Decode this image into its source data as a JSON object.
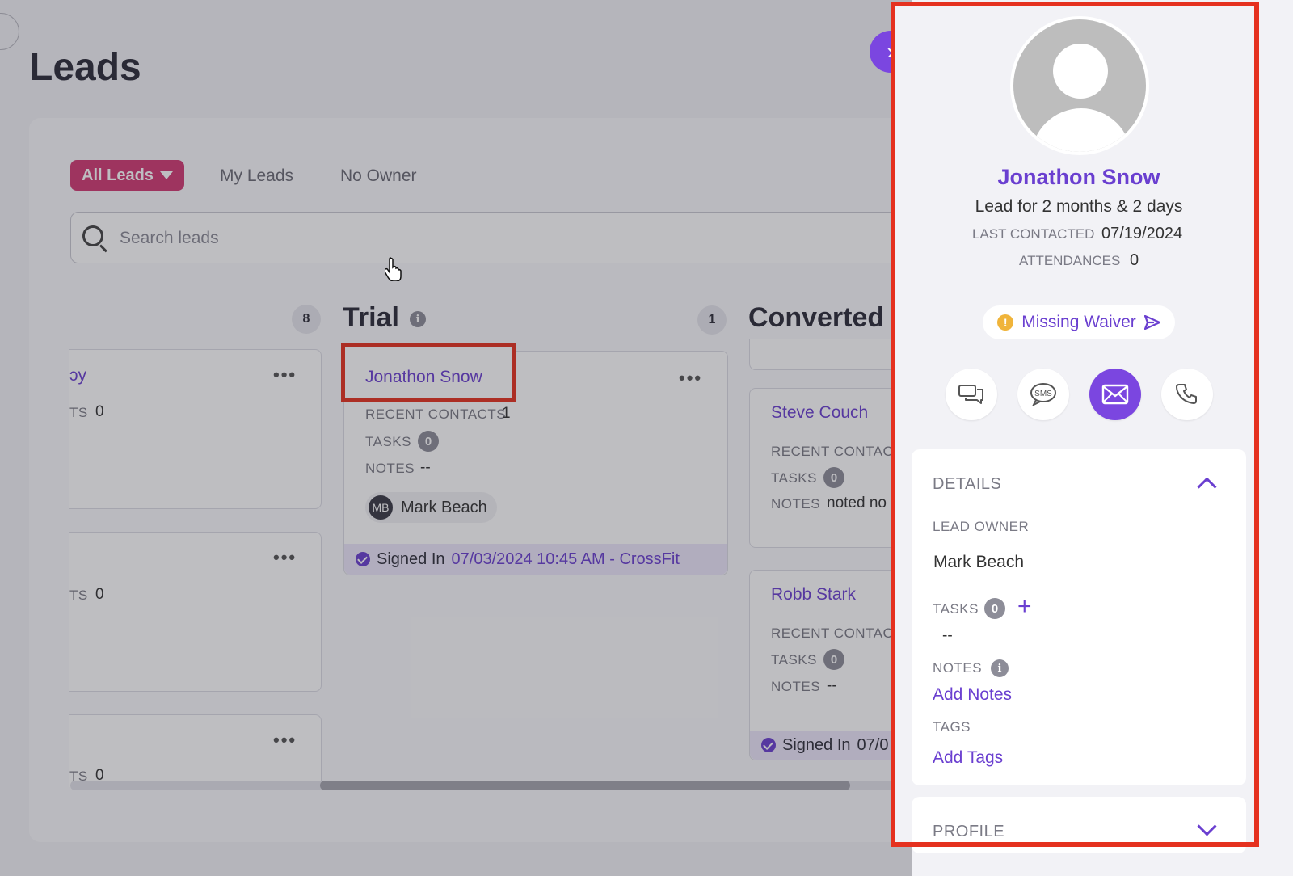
{
  "page": {
    "title": "Leads"
  },
  "filters": {
    "all": "All Leads",
    "mine": "My Leads",
    "none": "No Owner"
  },
  "search": {
    "placeholder": "Search leads"
  },
  "columns": {
    "left": {
      "count": "8",
      "card_label_partial": "TS",
      "card_value": "0",
      "name_partial": "ɔy",
      "more": "•••"
    },
    "trial": {
      "title": "Trial",
      "count": "1",
      "card": {
        "name": "Jonathon Snow",
        "recent_contacts_label": "RECENT CONTACTS",
        "recent_contacts": "1",
        "tasks_label": "TASKS",
        "tasks": "0",
        "notes_label": "NOTES",
        "notes": "--",
        "owner_initials": "MB",
        "owner": "Mark Beach",
        "signed_in_label": "Signed In",
        "signed_in_value": "07/03/2024 10:45 AM - CrossFit",
        "more": "•••"
      }
    },
    "converted": {
      "title": "Converted",
      "cards": [
        {
          "name": "Steve Couch",
          "recent_label": "RECENT CONTACT",
          "tasks_label": "TASKS",
          "tasks": "0",
          "notes_label": "NOTES",
          "notes": "noted no"
        },
        {
          "name": "Robb Stark",
          "recent_label": "RECENT CONTACT",
          "tasks_label": "TASKS",
          "tasks": "0",
          "notes_label": "NOTES",
          "notes": "--",
          "signed_in_label": "Signed In",
          "signed_in_partial": "07/0"
        }
      ]
    }
  },
  "panel": {
    "name": "Jonathon Snow",
    "lead_for": "Lead for 2 months & 2 days",
    "last_contacted_label": "LAST CONTACTED",
    "last_contacted": "07/19/2024",
    "attendances_label": "ATTENDANCES",
    "attendances": "0",
    "waiver": "Missing Waiver",
    "details": {
      "title": "DETAILS",
      "lead_owner_label": "LEAD OWNER",
      "lead_owner": "Mark Beach",
      "tasks_label": "TASKS",
      "tasks": "0",
      "tasks_value": "--",
      "notes_label": "NOTES",
      "add_notes": "Add Notes",
      "tags_label": "TAGS",
      "add_tags": "Add Tags"
    },
    "profile": {
      "title": "PROFILE"
    },
    "actions": {
      "sms": "SMS"
    }
  },
  "colors": {
    "accent": "#7b46e0",
    "filter_active": "#d23a73",
    "highlight": "#e5311f",
    "link": "#6a3fd0"
  }
}
